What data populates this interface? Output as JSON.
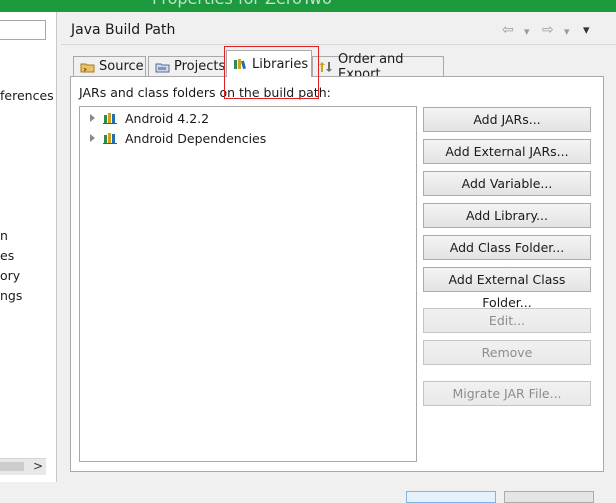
{
  "window": {
    "title": "Properties for ZeroTwo"
  },
  "left_panel": {
    "fragments": [
      "ferences",
      "n",
      "es",
      "ory",
      "ngs"
    ],
    "scroll_right": ">"
  },
  "page": {
    "title": "Java Build Path",
    "nav": {
      "back": "⇦",
      "back_menu": "▾",
      "forward": "⇨",
      "forward_menu": "▾",
      "menu": "▾"
    }
  },
  "tabs": [
    {
      "label": "Source",
      "icon": "source-folder-icon"
    },
    {
      "label": "Projects",
      "icon": "projects-icon"
    },
    {
      "label": "Libraries",
      "icon": "libraries-icon",
      "active": true
    },
    {
      "label": "Order and Export",
      "icon": "order-export-icon"
    }
  ],
  "libraries": {
    "description": "JARs and class folders on the build path:",
    "entries": [
      {
        "label": "Android 4.2.2",
        "icon": "library-icon"
      },
      {
        "label": "Android Dependencies",
        "icon": "library-icon"
      }
    ]
  },
  "buttons": {
    "add_jars": "Add JARs...",
    "add_external_jars": "Add External JARs...",
    "add_variable": "Add Variable...",
    "add_library": "Add Library...",
    "add_class_folder": "Add Class Folder...",
    "add_external_class_folder": "Add External Class Folder...",
    "edit": "Edit...",
    "remove": "Remove",
    "migrate_jar": "Migrate JAR File..."
  },
  "colors": {
    "highlight": "#e02020",
    "title_bar": "#1e9a3e"
  }
}
